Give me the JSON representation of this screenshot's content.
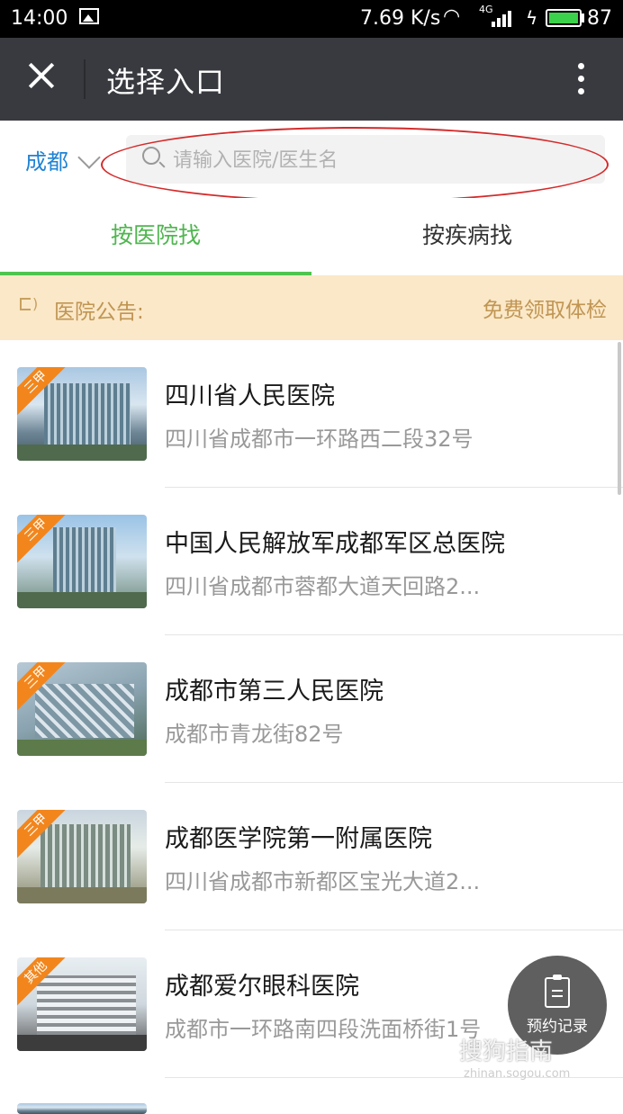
{
  "status_bar": {
    "time": "14:00",
    "net_speed": "7.69 K/s",
    "signal_label": "4G",
    "battery": "87",
    "battery_color": "#3bd14a"
  },
  "title_bar": {
    "title": "选择入口",
    "close_icon": "close-icon",
    "more_icon": "more-vertical-icon"
  },
  "search": {
    "city": "成都",
    "placeholder": "请输入医院/医生名",
    "value": ""
  },
  "tabs": [
    {
      "label": "按医院找",
      "active": true
    },
    {
      "label": "按疾病找",
      "active": false
    }
  ],
  "notice": {
    "label": "医院公告:",
    "promo": "免费领取体检"
  },
  "hospitals": [
    {
      "badge": "三甲",
      "name": "四川省人民医院",
      "address": "四川省成都市一环路西二段32号"
    },
    {
      "badge": "三甲",
      "name": "中国人民解放军成都军区总医院",
      "address": "四川省成都市蓉都大道天回路2..."
    },
    {
      "badge": "三甲",
      "name": "成都市第三人民医院",
      "address": "成都市青龙街82号"
    },
    {
      "badge": "三甲",
      "name": "成都医学院第一附属医院",
      "address": "四川省成都市新都区宝光大道2..."
    },
    {
      "badge": "其他",
      "name": "成都爱尔眼科医院",
      "address": "成都市一环路南四段洗面桥街1号"
    }
  ],
  "fab": {
    "label": "预约记录",
    "icon": "clipboard-icon"
  },
  "watermark": {
    "text": "搜狗指南",
    "url": "zhinan.sogou.com"
  },
  "colors": {
    "accent_green": "#4fc44f",
    "city_blue": "#1f83d4",
    "notice_bg": "#fbe8c8",
    "badge_orange": "#f2861c",
    "annotation_red": "#d42a2a"
  }
}
